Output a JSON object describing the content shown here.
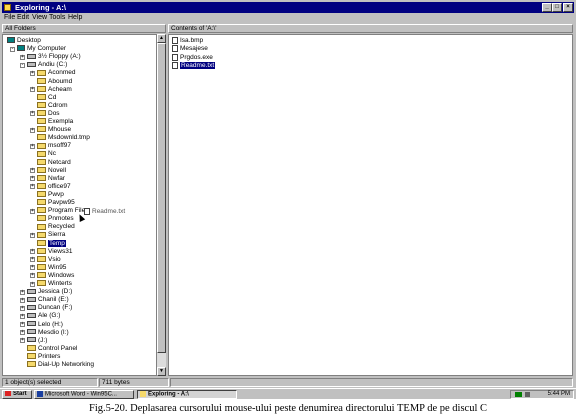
{
  "window": {
    "title": "Exploring - A:\\",
    "controls": [
      "_",
      "□",
      "×"
    ]
  },
  "menu": [
    "File",
    "Edit",
    "View",
    "Tools",
    "Help"
  ],
  "left_header": "All Folders",
  "right_header": "Contents of 'A:\\'",
  "tree": [
    {
      "label": "Desktop",
      "level": 0,
      "icon": "desktop-icon",
      "exp": ""
    },
    {
      "label": "My Computer",
      "level": 1,
      "icon": "computer-icon",
      "exp": "-"
    },
    {
      "label": "3½ Floppy (A:)",
      "level": 2,
      "icon": "floppy-icon",
      "exp": "+"
    },
    {
      "label": "Andiu (C:)",
      "level": 2,
      "icon": "drive-icon",
      "exp": "-"
    },
    {
      "label": "Aconmed",
      "level": 3,
      "icon": "folder-icon",
      "exp": "+"
    },
    {
      "label": "Aboumd",
      "level": 3,
      "icon": "folder-icon",
      "exp": ""
    },
    {
      "label": "Acheam",
      "level": 3,
      "icon": "folder-icon",
      "exp": "+"
    },
    {
      "label": "Cd",
      "level": 3,
      "icon": "folder-icon",
      "exp": ""
    },
    {
      "label": "Cdrom",
      "level": 3,
      "icon": "folder-icon",
      "exp": ""
    },
    {
      "label": "Dos",
      "level": 3,
      "icon": "folder-icon",
      "exp": "+"
    },
    {
      "label": "Exempla",
      "level": 3,
      "icon": "folder-icon",
      "exp": ""
    },
    {
      "label": "Mhouse",
      "level": 3,
      "icon": "folder-icon",
      "exp": "+"
    },
    {
      "label": "Msdownld.tmp",
      "level": 3,
      "icon": "folder-icon",
      "exp": ""
    },
    {
      "label": "msoff97",
      "level": 3,
      "icon": "folder-icon",
      "exp": "+"
    },
    {
      "label": "Nc",
      "level": 3,
      "icon": "folder-icon",
      "exp": ""
    },
    {
      "label": "Netcard",
      "level": 3,
      "icon": "folder-icon",
      "exp": ""
    },
    {
      "label": "Novell",
      "level": 3,
      "icon": "folder-icon",
      "exp": "+"
    },
    {
      "label": "Nwfar",
      "level": 3,
      "icon": "folder-icon",
      "exp": "+"
    },
    {
      "label": "office97",
      "level": 3,
      "icon": "folder-icon",
      "exp": "+"
    },
    {
      "label": "Pwvp",
      "level": 3,
      "icon": "folder-icon",
      "exp": ""
    },
    {
      "label": "Pavpw95",
      "level": 3,
      "icon": "folder-icon",
      "exp": ""
    },
    {
      "label": "Program Files",
      "level": 3,
      "icon": "folder-icon",
      "exp": "+"
    },
    {
      "label": "Pnmotes",
      "level": 3,
      "icon": "folder-icon",
      "exp": ""
    },
    {
      "label": "Recycled",
      "level": 3,
      "icon": "recycle-icon",
      "exp": ""
    },
    {
      "label": "Sierra",
      "level": 3,
      "icon": "folder-icon",
      "exp": "+"
    },
    {
      "label": "Temp",
      "level": 3,
      "icon": "folder-icon",
      "exp": "",
      "selected": true
    },
    {
      "label": "Views31",
      "level": 3,
      "icon": "folder-icon",
      "exp": "+"
    },
    {
      "label": "Vsio",
      "level": 3,
      "icon": "folder-icon",
      "exp": "+"
    },
    {
      "label": "Win95",
      "level": 3,
      "icon": "folder-icon",
      "exp": "+"
    },
    {
      "label": "Windows",
      "level": 3,
      "icon": "folder-icon",
      "exp": "+"
    },
    {
      "label": "Winterts",
      "level": 3,
      "icon": "folder-icon",
      "exp": "+"
    },
    {
      "label": "Jessica (D:)",
      "level": 2,
      "icon": "drive-icon",
      "exp": "+"
    },
    {
      "label": "Chanil (E:)",
      "level": 2,
      "icon": "drive-icon",
      "exp": "+"
    },
    {
      "label": "Duncan (F:)",
      "level": 2,
      "icon": "drive-icon",
      "exp": "+"
    },
    {
      "label": "Ale (G:)",
      "level": 2,
      "icon": "drive-icon",
      "exp": "+"
    },
    {
      "label": "Lelo (H:)",
      "level": 2,
      "icon": "drive-icon",
      "exp": "+"
    },
    {
      "label": "Mesdio (I:)",
      "level": 2,
      "icon": "drive-icon",
      "exp": "+"
    },
    {
      "label": "(J:)",
      "level": 2,
      "icon": "cdrom-icon",
      "exp": "+"
    },
    {
      "label": "Control Panel",
      "level": 2,
      "icon": "folder-icon",
      "exp": ""
    },
    {
      "label": "Printers",
      "level": 2,
      "icon": "folder-icon",
      "exp": ""
    },
    {
      "label": "Dial-Up Networking",
      "level": 2,
      "icon": "folder-icon",
      "exp": ""
    }
  ],
  "drag_label": "Readme.txt",
  "files": [
    {
      "name": "Isa.bmp",
      "selected": false
    },
    {
      "name": "Mesajese",
      "selected": false
    },
    {
      "name": "Prgdos.exe",
      "selected": false
    },
    {
      "name": "Readme.txt",
      "selected": true
    }
  ],
  "status": {
    "left": "1 object(s) selected",
    "mid": "711 bytes"
  },
  "taskbar": {
    "start": "Start",
    "items": [
      "Microsoft Word - Win95C...",
      "Exploring - A:\\"
    ],
    "clock": "5:44 PM"
  },
  "caption": "Fig.5-20. Deplasarea cursorului mouse-ului peste denumirea directorului TEMP de pe discul C"
}
